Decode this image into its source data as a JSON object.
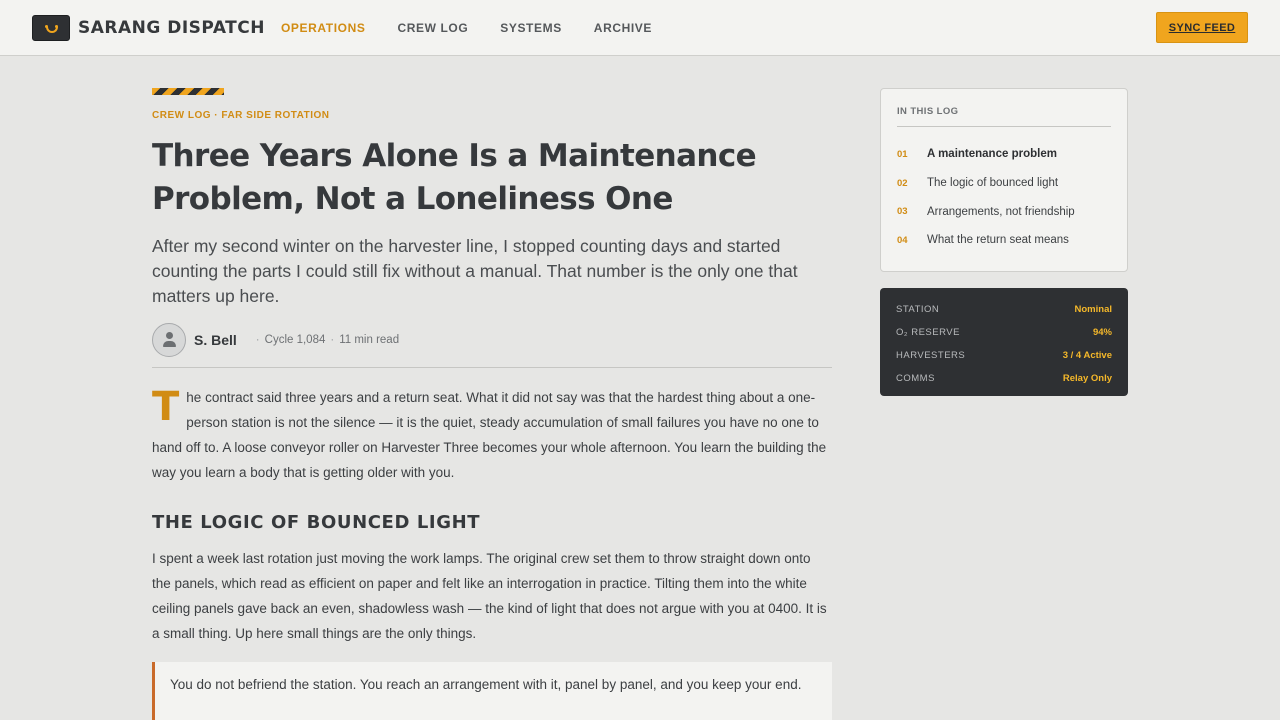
{
  "header": {
    "brand": "SARANG DISPATCH",
    "nav": [
      {
        "label": "OPERATIONS",
        "active": true
      },
      {
        "label": "CREW LOG"
      },
      {
        "label": "SYSTEMS"
      },
      {
        "label": "ARCHIVE"
      }
    ],
    "sync_label": "SYNC FEED"
  },
  "article": {
    "kicker": "CREW LOG · FAR SIDE ROTATION",
    "title": "Three Years Alone Is a Maintenance Problem, Not a Loneliness One",
    "dek": "After my second winter on the harvester line, I stopped counting days and started counting the parts I could still fix without a manual. That number is the only one that matters up here.",
    "author": "S. Bell",
    "cycle": "Cycle 1,084",
    "read_time": "11 min read",
    "p1_dropcap": "T",
    "p1_text": "he contract said three years and a return seat. What it did not say was that the hardest thing about a one-person station is not the silence — it is the quiet, steady accumulation of small failures you have no one to hand off to. A loose conveyor roller on Harvester Three becomes your whole afternoon. You learn the building the way you learn a body that is getting older with you.",
    "section_1": "THE LOGIC OF BOUNCED LIGHT",
    "p2_text": "I spent a week last rotation just moving the work lamps. The original crew set them to throw straight down onto the panels, which read as efficient on paper and felt like an interrogation in practice. Tilting them into the white ceiling panels gave back an even, shadowless wash — the kind of light that does not argue with you at 0400. It is a small thing. Up here small things are the only things.",
    "pullquote": "You do not befriend the station. You reach an arrangement with it, panel by panel, and you keep your end."
  },
  "toc": {
    "title": "IN THIS LOG",
    "items": [
      {
        "num": "01",
        "label": "A maintenance problem",
        "active": true
      },
      {
        "num": "02",
        "label": "The logic of bounced light"
      },
      {
        "num": "03",
        "label": "Arrangements, not friendship"
      },
      {
        "num": "04",
        "label": "What the return seat means"
      }
    ]
  },
  "status": {
    "rows": [
      {
        "key": "STATION",
        "value": "Nominal"
      },
      {
        "key": "O₂ RESERVE",
        "value": "94%"
      },
      {
        "key": "HARVESTERS",
        "value": "3 / 4 Active"
      },
      {
        "key": "COMMS",
        "value": "Relay Only"
      }
    ]
  },
  "colors": {
    "accent": "#f0a51e",
    "accent_text": "#d18c14",
    "ink": "#36393c",
    "background": "#e6e6e4",
    "panel_dark": "#2e3033",
    "quote_rule": "#c96a2a"
  }
}
